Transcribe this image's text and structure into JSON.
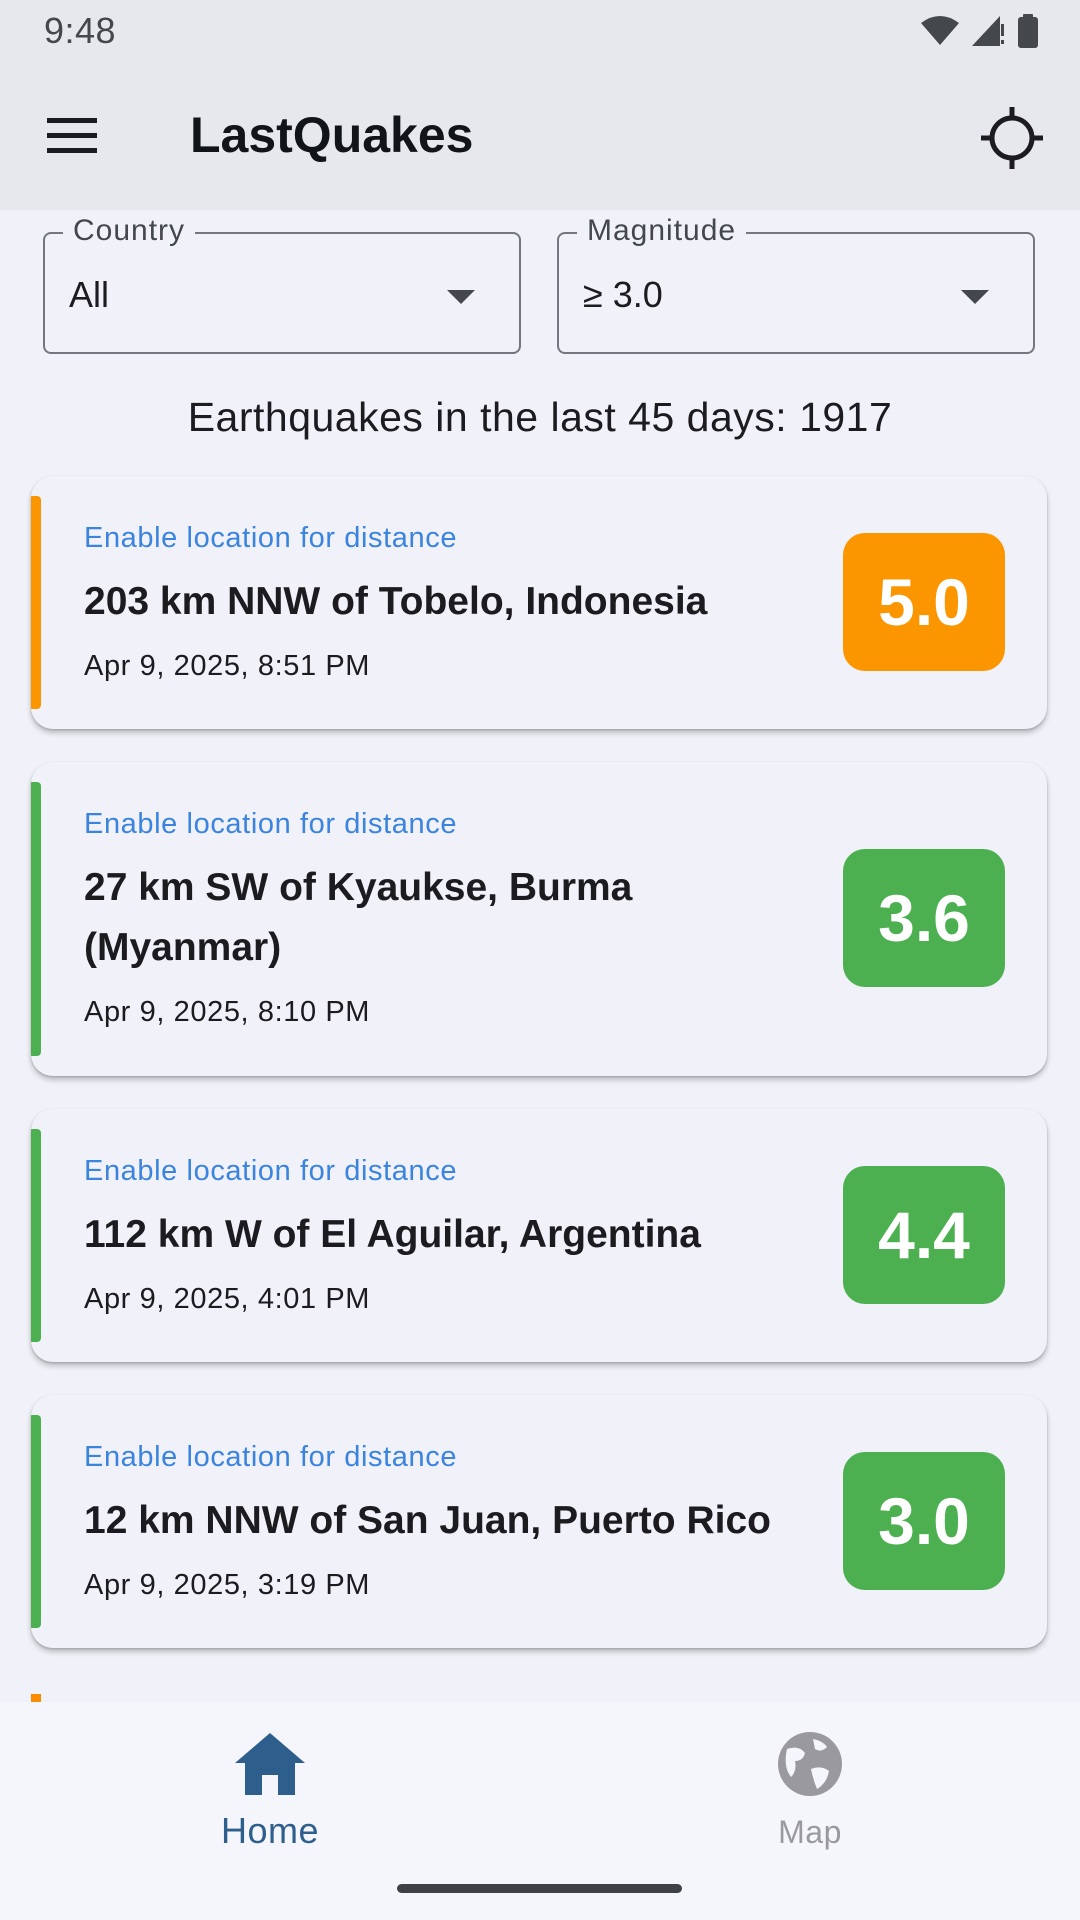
{
  "status_bar": {
    "time": "9:48"
  },
  "app_bar": {
    "title": "LastQuakes",
    "menu_icon": "menu-icon",
    "locate_icon": "my-location-icon"
  },
  "filters": {
    "country": {
      "label": "Country",
      "value": "All"
    },
    "magnitude": {
      "label": "Magnitude",
      "value": "≥ 3.0"
    }
  },
  "summary": "Earthquakes in the last 45 days: 1917",
  "colors": {
    "orange": "#fb9500",
    "green": "#4caf50",
    "hint_blue": "#3a84e0",
    "nav_active": "#2e5e8c"
  },
  "quakes": [
    {
      "hint": "Enable location for distance",
      "place": "203 km NNW of Tobelo, Indonesia",
      "time": "Apr 9, 2025, 8:51 PM",
      "magnitude": "5.0",
      "color": "#fb9500"
    },
    {
      "hint": "Enable location for distance",
      "place": "27 km SW of Kyaukse, Burma (Myanmar)",
      "time": "Apr 9, 2025, 8:10 PM",
      "magnitude": "3.6",
      "color": "#4caf50"
    },
    {
      "hint": "Enable location for distance",
      "place": "112 km W of El Aguilar, Argentina",
      "time": "Apr 9, 2025, 4:01 PM",
      "magnitude": "4.4",
      "color": "#4caf50"
    },
    {
      "hint": "Enable location for distance",
      "place": "12 km NNW of San Juan, Puerto Rico",
      "time": "Apr 9, 2025, 3:19 PM",
      "magnitude": "3.0",
      "color": "#4caf50"
    }
  ],
  "bottom_nav": {
    "home": {
      "label": "Home",
      "icon": "home-icon"
    },
    "map": {
      "label": "Map",
      "icon": "globe-icon"
    }
  }
}
